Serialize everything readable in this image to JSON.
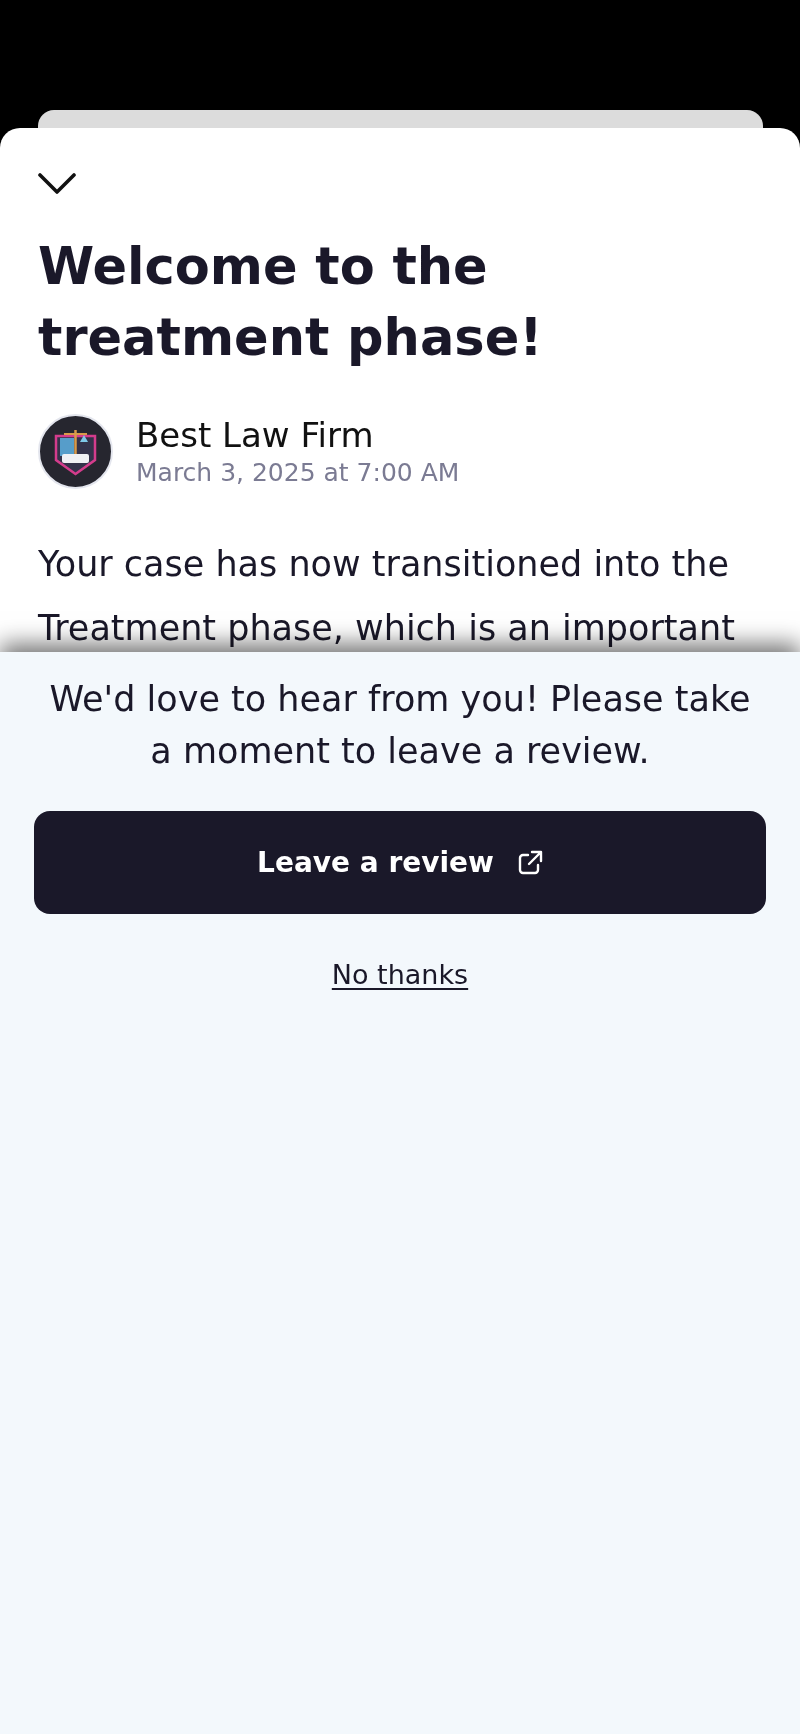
{
  "article": {
    "title": "Welcome to the treatment phase!",
    "author": "Best Law Firm",
    "date": "March 3, 2025 at 7:00 AM",
    "body": "Your case has now transitioned into the Treatment phase, which is an important"
  },
  "review_prompt": {
    "message": "We'd love to hear from you! Please take a moment to leave a review.",
    "primary_button": "Leave a review",
    "secondary_link": "No thanks"
  }
}
